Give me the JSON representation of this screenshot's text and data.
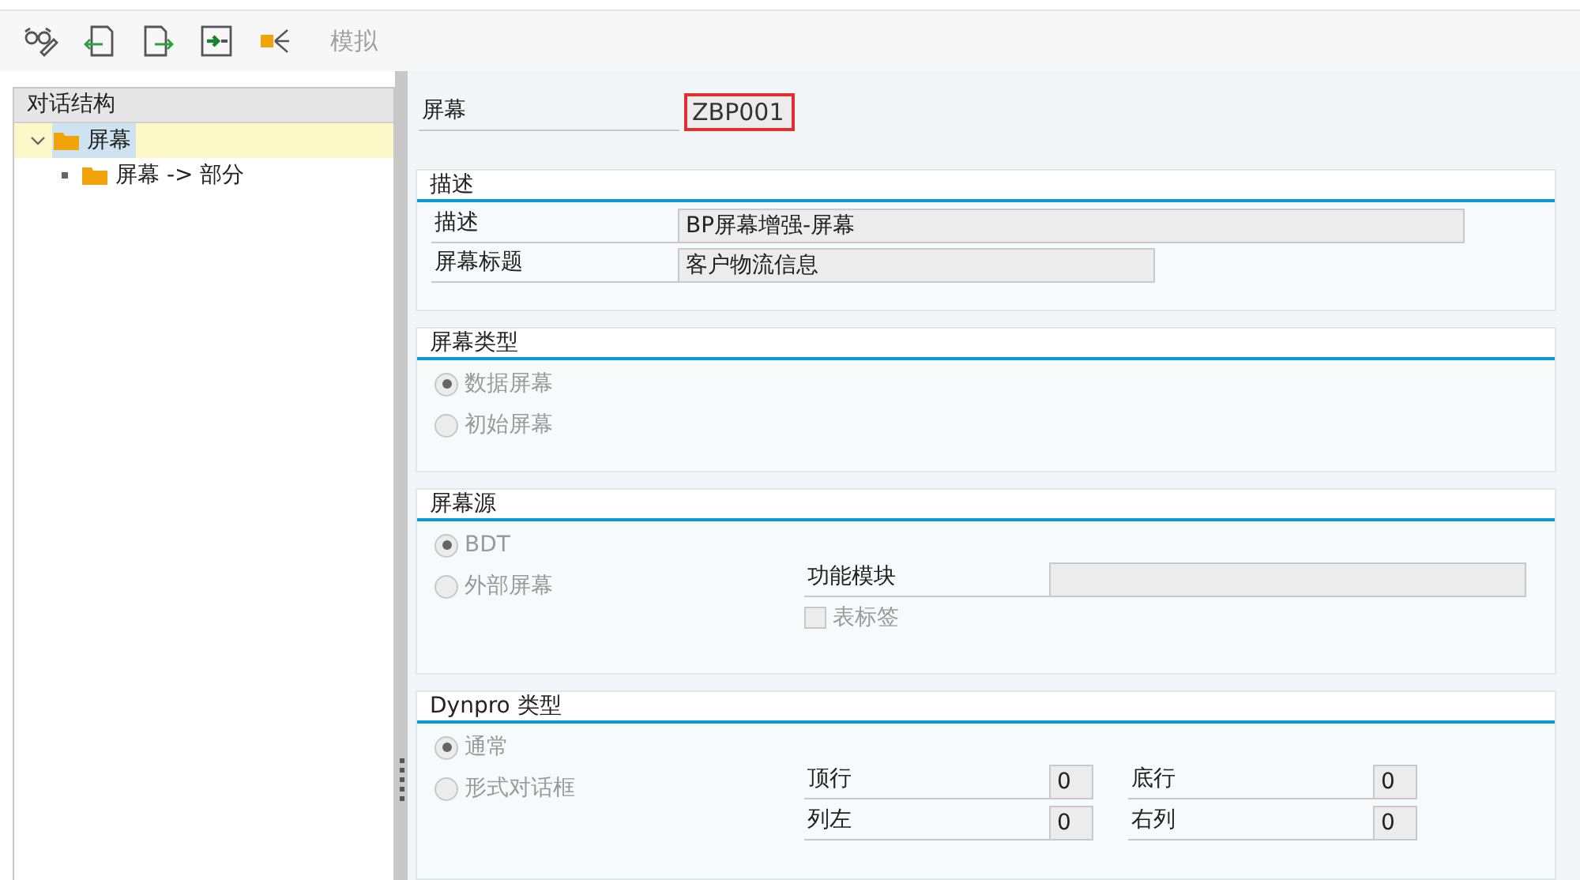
{
  "toolbar": {
    "label": "模拟",
    "disabled": true
  },
  "tree": {
    "header": "对话结构",
    "items": [
      {
        "label": "屏幕",
        "expanded": true,
        "selected": true,
        "children": [
          {
            "label": "屏幕 -> 部分",
            "selected": false
          }
        ]
      }
    ]
  },
  "screen_field": {
    "label": "屏幕",
    "value": "ZBP001",
    "focused": true
  },
  "description_group": {
    "title": "描述",
    "fields": [
      {
        "label": "描述",
        "value": "BP屏幕增强-屏幕"
      },
      {
        "label": "屏幕标题",
        "value": "客户物流信息"
      }
    ]
  },
  "screen_type_group": {
    "title": "屏幕类型",
    "disabled": true,
    "options": [
      {
        "label": "数据屏幕",
        "selected": true
      },
      {
        "label": "初始屏幕",
        "selected": false
      }
    ]
  },
  "screen_source_group": {
    "title": "屏幕源",
    "disabled": true,
    "options": [
      {
        "label": "BDT",
        "selected": true
      },
      {
        "label": "外部屏幕",
        "selected": false
      }
    ],
    "function_module": {
      "label": "功能模块"
    },
    "tab_checkbox": {
      "label": "表标签",
      "checked": false
    }
  },
  "dynpro_group": {
    "title": "Dynpro 类型",
    "disabled": true,
    "options": [
      {
        "label": "通常",
        "selected": true
      },
      {
        "label": "形式对话框",
        "selected": false
      }
    ],
    "fields": [
      {
        "label": "顶行",
        "value": "0"
      },
      {
        "label": "底行",
        "value": "0"
      },
      {
        "label": "列左",
        "value": "0"
      },
      {
        "label": "右列",
        "value": "0"
      }
    ]
  }
}
